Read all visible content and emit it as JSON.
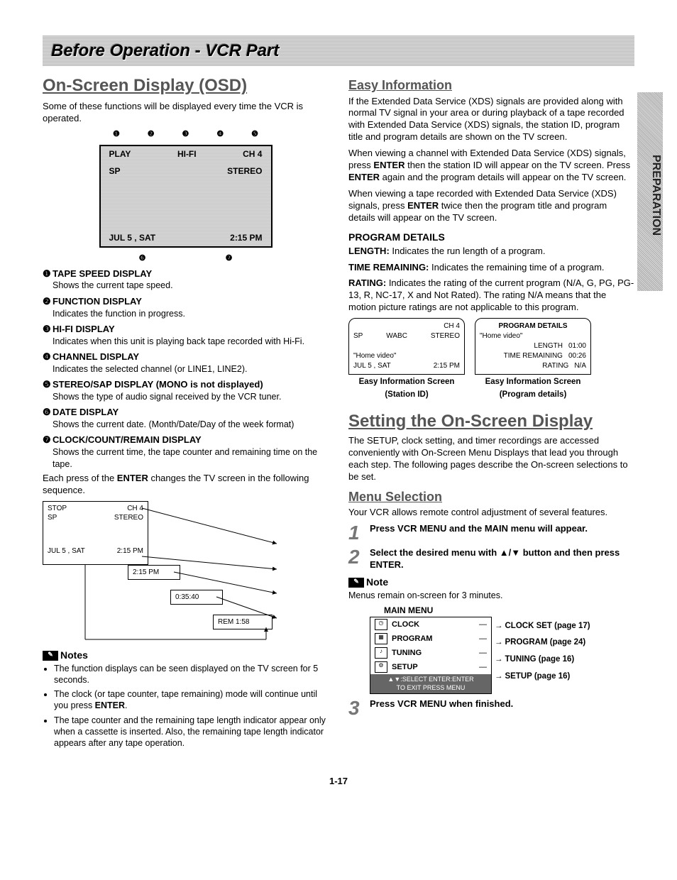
{
  "banner": "Before Operation - VCR Part",
  "side_tab": "PREPARATION",
  "page_number": "1-17",
  "left": {
    "h1": "On-Screen Display (OSD)",
    "intro": "Some of these functions will be displayed every time the VCR is operated.",
    "callout_top": [
      "❶",
      "❷",
      "❸",
      "❹",
      "❺"
    ],
    "osd": {
      "r1": [
        "PLAY",
        "HI-FI",
        "CH  4"
      ],
      "r2": [
        "SP",
        "",
        "STEREO"
      ],
      "r3": [
        "JUL  5 , SAT",
        "2:15 PM"
      ]
    },
    "callout_bot": [
      "❻",
      "❼"
    ],
    "defs": [
      {
        "n": "❶",
        "t": "TAPE SPEED DISPLAY",
        "d": "Shows the current tape speed."
      },
      {
        "n": "❷",
        "t": "FUNCTION DISPLAY",
        "d": "Indicates the function in progress."
      },
      {
        "n": "❸",
        "t": "HI-FI DISPLAY",
        "d": "Indicates when this unit is playing back tape recorded with Hi-Fi."
      },
      {
        "n": "❹",
        "t": "CHANNEL DISPLAY",
        "d": "Indicates the selected channel (or LINE1, LINE2)."
      },
      {
        "n": "❺",
        "t": "STEREO/SAP DISPLAY (MONO is not displayed)",
        "d": "Shows the type of audio signal received by the VCR tuner."
      },
      {
        "n": "❻",
        "t": "DATE DISPLAY",
        "d": "Shows the current date. (Month/Date/Day of the week format)"
      },
      {
        "n": "❼",
        "t": "CLOCK/COUNT/REMAIN DISPLAY",
        "d": "Shows the current time, the tape counter and remaining time on the tape."
      }
    ],
    "enter_para": "Each press of the ENTER changes the TV screen in the following sequence.",
    "seq": {
      "b1_top": [
        "STOP",
        "CH  4"
      ],
      "b1_mid": [
        "SP",
        "STEREO"
      ],
      "b1_bot": [
        "JUL  5 , SAT",
        "2:15 PM"
      ],
      "b2": "2:15 PM",
      "b3": "0:35:40",
      "b4": "REM 1:58"
    },
    "notes_hdr": "Notes",
    "notes": [
      "The function displays can be seen displayed on the TV screen for 5 seconds.",
      "The clock (or tape counter, tape remaining) mode will continue until you press ENTER.",
      "The tape counter and the remaining tape length indicator appear only when a cassette is inserted. Also, the remaining tape length indicator appears after any tape operation."
    ]
  },
  "right": {
    "easy_h": "Easy Information",
    "easy_p1": "If the Extended Data Service (XDS) signals are provided along with normal TV signal in your area or during playback of a tape recorded with Extended Data Service (XDS) signals, the station ID, program title and program details are shown on the TV screen.",
    "easy_p2": "When viewing a channel with Extended Data Service (XDS) signals, press ENTER then the station ID will appear on the TV screen. Press ENTER again and the program details will appear on the TV screen.",
    "easy_p3": "When viewing a tape recorded with Extended  Data Service (XDS) signals, press ENTER twice then the program title and program details will appear on the TV screen.",
    "pd_h": "PROGRAM DETAILS",
    "pd_len_l": "LENGTH:",
    "pd_len_t": " Indicates the run length of a program.",
    "pd_tr_l": "TIME REMAINING:",
    "pd_tr_t": " Indicates the remaining time of a program.",
    "pd_r_l": "RATING:",
    "pd_r_t": " Indicates the rating of the current program (N/A, G, PG, PG-13, R, NC-17, X and Not Rated). The rating N/A means that the motion picture ratings are not applicable to this program.",
    "mini1": {
      "r1": [
        "",
        "CH  4"
      ],
      "r2": [
        "SP",
        "WABC",
        "STEREO"
      ],
      "r3": [
        "\"Home video\"",
        ""
      ],
      "r4": [
        "JUL  5 , SAT",
        "2:15 PM"
      ],
      "cap1": "Easy Information Screen",
      "cap2": "(Station ID)"
    },
    "mini2": {
      "t": "PROGRAM DETAILS",
      "l1": "\"Home video\"",
      "l2": [
        "LENGTH",
        "01:00"
      ],
      "l3": [
        "TIME REMAINING",
        "00:26"
      ],
      "l4": [
        "RATING",
        "N/A"
      ],
      "cap1": "Easy Information Screen",
      "cap2": "(Program details)"
    },
    "set_h": "Setting the On-Screen Display",
    "set_p": "The SETUP, clock setting, and timer recordings are accessed conveniently with On-Screen Menu Displays that lead you through each step. The following pages describe the On-screen selections to be set.",
    "menu_h": "Menu Selection",
    "menu_p": "Your VCR allows remote control adjustment of several features.",
    "step1": "Press VCR MENU and the MAIN menu will appear.",
    "step2": "Select the desired menu with ▲/▼ button and then press ENTER.",
    "note_h": "Note",
    "note_t": "Menus remain on-screen for 3 minutes.",
    "main_menu_t": "MAIN MENU",
    "menu_items": [
      "CLOCK",
      "PROGRAM",
      "TUNING",
      "SETUP"
    ],
    "menu_footer1": "▲▼:SELECT  ENTER:ENTER",
    "menu_footer2": "TO  EXIT PRESS  MENU",
    "menu_targets": [
      "CLOCK SET (page 17)",
      "PROGRAM (page 24)",
      "TUNING (page 16)",
      "SETUP (page 16)"
    ],
    "step3": "Press VCR MENU when finished."
  }
}
